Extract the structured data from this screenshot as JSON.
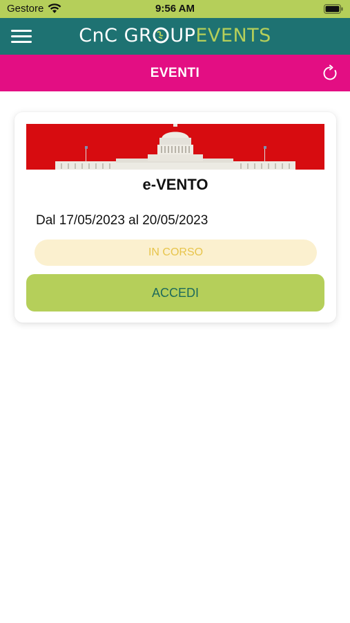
{
  "status_bar": {
    "carrier": "Gestore",
    "time": "9:56 AM",
    "wifi_icon": "wifi-icon",
    "battery_icon": "battery-icon"
  },
  "header": {
    "logo_part_a": "CnC GR",
    "logo_part_b": "UP",
    "logo_part_c": "EVENTS",
    "menu_icon": "hamburger-menu-icon",
    "colors": {
      "header_bg": "#1e7272",
      "accent": "#b5cf5a"
    }
  },
  "title_bar": {
    "title": "EVENTI",
    "refresh_icon": "refresh-icon",
    "color": "#e30e83"
  },
  "event": {
    "title": "e-VENTO",
    "dates": "Dal 17/05/2023 al 20/05/2023",
    "status": "IN CORSO",
    "action_label": "ACCEDI",
    "banner_icon": "capitol-building-image"
  }
}
